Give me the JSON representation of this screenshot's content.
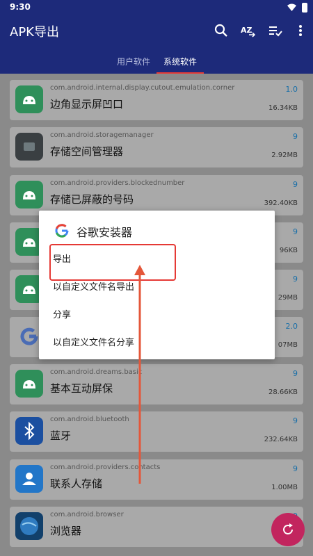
{
  "status_bar": {
    "time": "9:30"
  },
  "app_bar": {
    "title": "APK导出",
    "actions": [
      "search-icon",
      "sort-az-icon",
      "checklist-icon",
      "more-vert-icon"
    ],
    "tabs": [
      {
        "label": "用户软件",
        "active": false
      },
      {
        "label": "系统软件",
        "active": true
      }
    ],
    "accent": "#1d2a7a",
    "indicator_color": "#e53935"
  },
  "apps": [
    {
      "package": "com.android.internal.display.cutout.emulation.corner",
      "name": "边角显示屏凹口",
      "version": "1.0",
      "size": "16.34KB",
      "icon": "android-icon"
    },
    {
      "package": "com.android.storagemanager",
      "name": "存储空间管理器",
      "version": "9",
      "size": "2.92MB",
      "icon": "storage-icon"
    },
    {
      "package": "com.android.providers.blockednumber",
      "name": "存储已屏蔽的号码",
      "version": "9",
      "size": "392.40KB",
      "icon": "android-icon"
    },
    {
      "package": "",
      "name": "",
      "version": "9",
      "size": "96KB",
      "icon": "android-icon"
    },
    {
      "package": "",
      "name": "",
      "version": "9",
      "size": "29MB",
      "icon": "android-icon"
    },
    {
      "package": "",
      "name": "",
      "version": "2.0",
      "size": "07MB",
      "icon": "google-icon"
    },
    {
      "package": "com.android.dreams.basic",
      "name": "基本互动屏保",
      "version": "9",
      "size": "28.66KB",
      "icon": "android-icon"
    },
    {
      "package": "com.android.bluetooth",
      "name": "蓝牙",
      "version": "9",
      "size": "232.64KB",
      "icon": "bluetooth-icon"
    },
    {
      "package": "com.android.providers.contacts",
      "name": "联系人存储",
      "version": "9",
      "size": "1.00MB",
      "icon": "contacts-icon"
    },
    {
      "package": "com.android.browser",
      "name": "浏览器",
      "version": "9",
      "size": "",
      "icon": "browser-icon"
    }
  ],
  "dialog": {
    "title": "谷歌安装器",
    "options": [
      "导出",
      "以自定义文件名导出",
      "分享",
      "以自定义文件名分享"
    ]
  },
  "fab": {
    "icon": "refresh-icon",
    "color": "#c2255e"
  }
}
